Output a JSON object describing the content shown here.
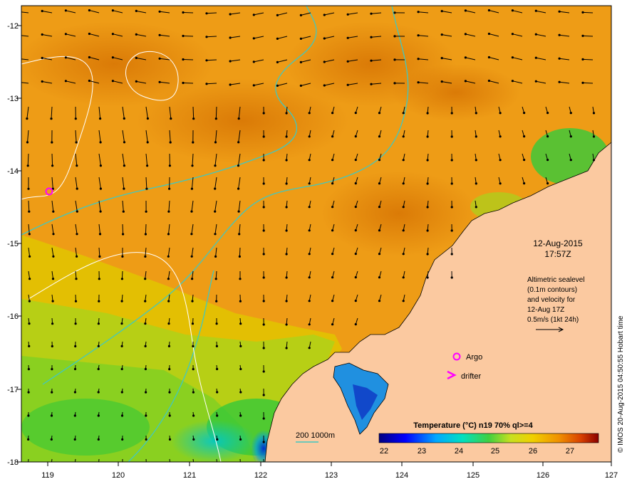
{
  "map": {
    "lon_ticks": [
      "119",
      "120",
      "121",
      "122",
      "123",
      "124",
      "125",
      "126",
      "127"
    ],
    "lat_ticks": [
      "-12",
      "-13",
      "-14",
      "-15",
      "-16",
      "-17",
      "-18"
    ],
    "date_line1": "12-Aug-2015",
    "date_line2": "17:57Z",
    "altimetry_lines": [
      "Altimetric sealevel",
      "(0.1m contours)",
      "and velocity for",
      "12-Aug 17Z",
      "0.5m/s (1kt 24h)"
    ],
    "legend_argo": "Argo",
    "legend_drifter": "drifter",
    "isobath_label": "200  1000m",
    "colorbar_title": "Temperature (°C) n19 70% ql>=4",
    "colorbar_ticks": [
      "22",
      "23",
      "24",
      "25",
      "26",
      "27"
    ],
    "side_credit": "© IMOS 20-Aug-2015 04:50:55 Hobart time"
  },
  "colors": {
    "land": "#fbc9a0",
    "isobath": "#40c8c0",
    "contour": "#ffffff",
    "argo": "#ff00ff",
    "drifter": "#ff00ff",
    "arrows": "#000000"
  }
}
